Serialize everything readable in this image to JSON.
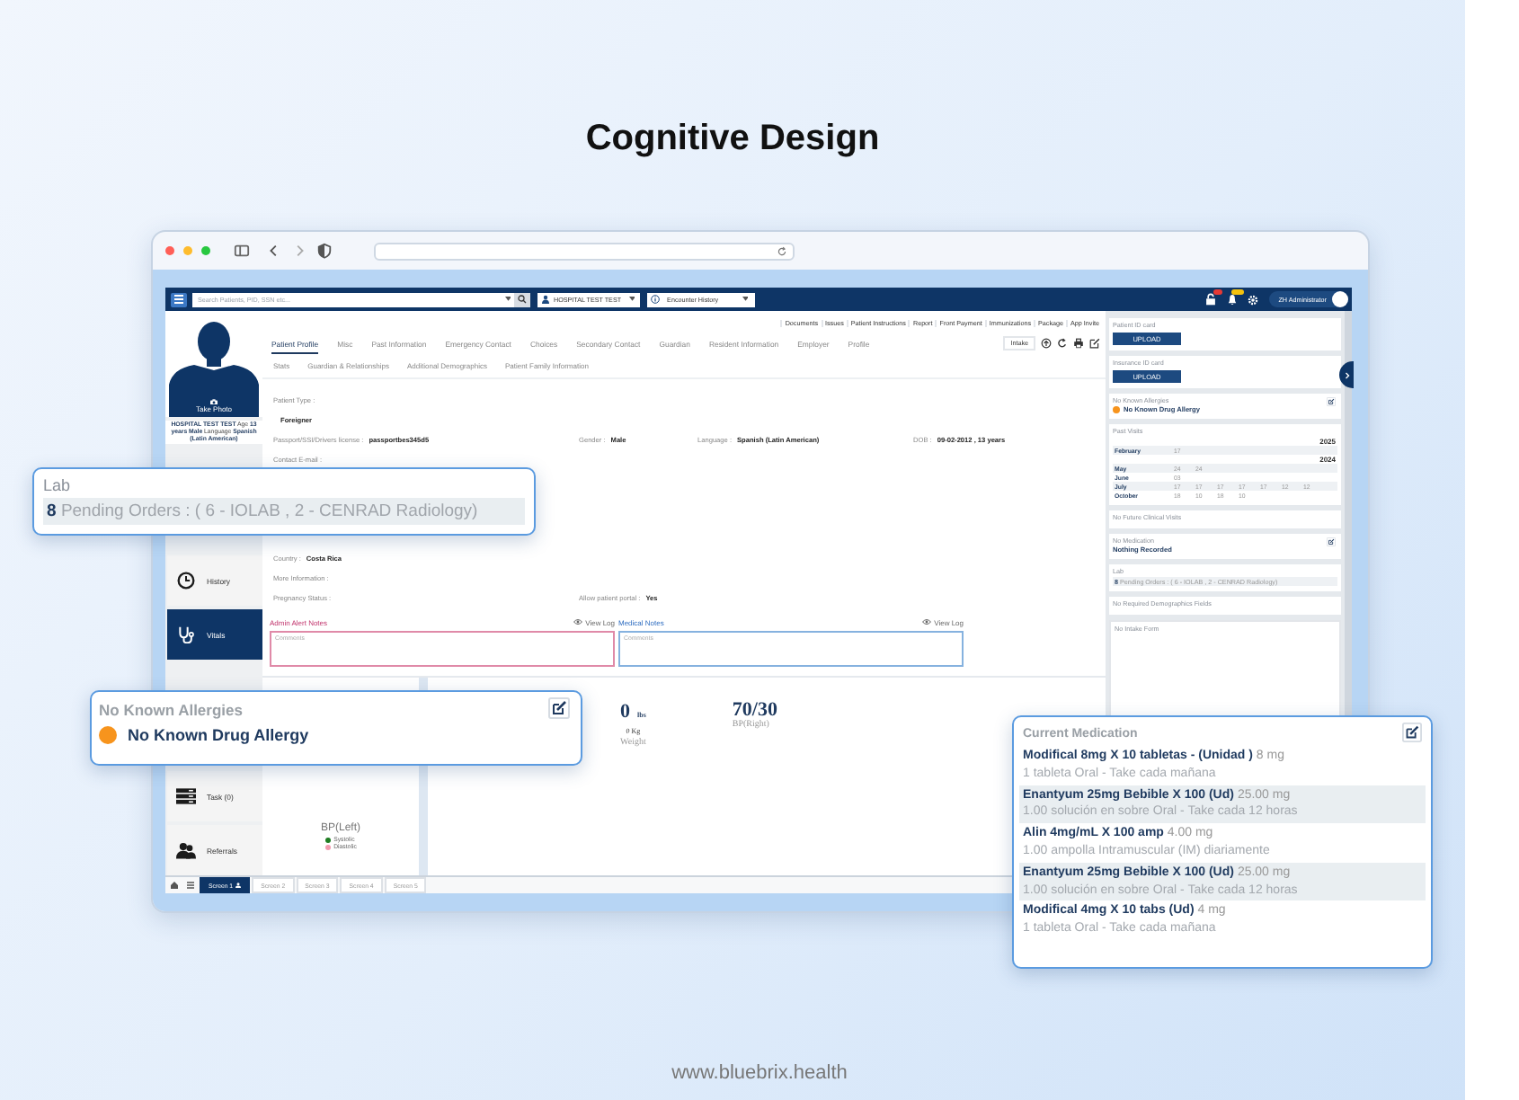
{
  "heading": "Cognitive Design",
  "app_bar": {
    "search_placeholder": "Search Patients, PID, SSN etc...",
    "facility": "HOSPITAL TEST TEST",
    "encounter": "Encounter History",
    "user": "ZH Administrator"
  },
  "top_links": [
    "Documents",
    "Issues",
    "Patient Instructions",
    "Report",
    "Front Payment",
    "Immunizations",
    "Package",
    "App Invite"
  ],
  "photo_label": "Take Photo",
  "patient_summary": "**HOSPITAL TEST TEST** Age **13 years** **Male** Language **Spanish (Latin American)**",
  "nav": [
    {
      "label": "History",
      "kind": "clock",
      "selected": false
    },
    {
      "label": "Vitals",
      "kind": "stethoscope",
      "selected": true
    },
    {
      "label": "Task (0)",
      "kind": "task",
      "selected": false
    },
    {
      "label": "Referrals",
      "kind": "people",
      "selected": false
    }
  ],
  "tabs": [
    {
      "label": "Patient Profile",
      "selected": true
    },
    {
      "label": "Misc",
      "selected": false
    },
    {
      "label": "Past Information",
      "selected": false
    },
    {
      "label": "Emergency Contact",
      "selected": false
    },
    {
      "label": "Choices",
      "selected": false
    },
    {
      "label": "Secondary Contact",
      "selected": false
    },
    {
      "label": "Guardian",
      "selected": false
    },
    {
      "label": "Resident Information",
      "selected": false
    },
    {
      "label": "Employer",
      "selected": false
    },
    {
      "label": "Profile",
      "selected": false
    }
  ],
  "subtabs": [
    "Stats",
    "Guardian & Relationships",
    "Additional Demographics",
    "Patient Family Information"
  ],
  "intake_button": "Intake",
  "field_rows": [
    [
      {
        "label": "Patient Type :"
      }
    ],
    [
      {
        "value": "Foreigner"
      }
    ],
    [
      {
        "label": "Passport/SSI/Drivers license :",
        "value": "passportbes345d5"
      },
      {
        "label": "Gender :",
        "value": "Male"
      },
      {
        "label": "Language :",
        "value": "Spanish (Latin American)"
      },
      {
        "label": "DOB :",
        "value": "09-02-2012 , 13 years"
      }
    ],
    [
      {
        "label": "Contact E-mail :"
      }
    ],
    [
      {
        "label": "Country :",
        "value": "Costa Rica"
      }
    ],
    [
      {
        "label": "More Information :"
      }
    ],
    [
      {
        "label": "Pregnancy Status :"
      },
      {
        "label": "Allow patient portal :",
        "value": "Yes"
      }
    ]
  ],
  "notes": [
    {
      "title": "Admin Alert Notes",
      "kind": "alert",
      "view_log": "View Log",
      "placeholder": "Comments"
    },
    {
      "title": "Medical Notes",
      "kind": "medical",
      "view_log": "View Log",
      "placeholder": "Comments"
    }
  ],
  "bp_left": {
    "title": "BP(Left)",
    "legend": [
      {
        "label": "Systolic",
        "color": "#1e7d22"
      },
      {
        "label": "Diastolic",
        "color": "#f29bb0"
      }
    ]
  },
  "weight": {
    "value": "0",
    "unit": "lbs",
    "metric": "0 Kg",
    "label": "Weight"
  },
  "bp_right": {
    "value": "70/30",
    "label": "BP(Right)"
  },
  "screens": [
    {
      "label": "Screen 1",
      "selected": true
    },
    {
      "label": "Screen 2",
      "selected": false
    },
    {
      "label": "Screen 3",
      "selected": false
    },
    {
      "label": "Screen 4",
      "selected": false
    },
    {
      "label": "Screen 5",
      "selected": false
    }
  ],
  "side_cards": [
    {
      "kind": "upload",
      "title": "Patient ID card",
      "button": "UPLOAD"
    },
    {
      "kind": "upload",
      "title": "Insurance ID card",
      "button": "UPLOAD"
    },
    {
      "kind": "allergy",
      "title": "No Known Allergies",
      "item": "No Known Drug Allergy",
      "color": "#f7941d"
    },
    {
      "kind": "visits",
      "title": "Past Visits",
      "years": [
        {
          "year": "2025",
          "months": [
            {
              "month": "February",
              "days": [
                "17"
              ]
            }
          ]
        },
        {
          "year": "2024",
          "months": [
            {
              "month": "May",
              "days": [
                "24",
                "24"
              ]
            },
            {
              "month": "June",
              "days": [
                "03"
              ]
            },
            {
              "month": "July",
              "days": [
                "17",
                "17",
                "17",
                "17",
                "17",
                "12",
                "12"
              ]
            },
            {
              "month": "October",
              "days": [
                "18",
                "10",
                "18",
                "10"
              ]
            }
          ]
        }
      ]
    },
    {
      "kind": "plain",
      "title": "No Future Clinical Visits"
    },
    {
      "kind": "note",
      "title": "No Medication",
      "text": "Nothing Recorded"
    },
    {
      "kind": "lab",
      "title": "Lab",
      "count": "8",
      "text": "Pending Orders : ( 6 - IOLAB , 2 - CENRAD Radiology)"
    },
    {
      "kind": "plain",
      "title": "No Required Demographics Fields"
    },
    {
      "kind": "intake",
      "title": "No Intake Form"
    }
  ],
  "lab_callout": {
    "title": "Lab",
    "count": "8",
    "text": "Pending Orders : ( 6 - IOLAB , 2 - CENRAD Radiology)"
  },
  "allergy_callout": {
    "title": "No Known Allergies",
    "item": "No Known Drug Allergy",
    "color": "#f7941d"
  },
  "medication_callout": {
    "title": "Current Medication",
    "items": [
      {
        "name": "Modifical 8mg X 10 tabletas - (Unidad )",
        "dose": "8 mg",
        "instructions": "1 tableta Oral - Take cada mañana"
      },
      {
        "name": "Enantyum 25mg Bebible X 100 (Ud)",
        "dose": "25.00 mg",
        "instructions": "1.00 solución en sobre Oral - Take cada 12 horas"
      },
      {
        "name": "Alin 4mg/mL X 100 amp",
        "dose": "4.00 mg",
        "instructions": "1.00 ampolla Intramuscular (IM) diariamente"
      },
      {
        "name": "Enantyum 25mg Bebible X 100 (Ud)",
        "dose": "25.00 mg",
        "instructions": "1.00 solución en sobre Oral - Take cada 12 horas"
      },
      {
        "name": "Modifical 4mg X 10 tabs (Ud)",
        "dose": "4 mg",
        "instructions": "1 tableta Oral - Take cada mañana"
      }
    ]
  },
  "footer": "www.bluebrix.health"
}
